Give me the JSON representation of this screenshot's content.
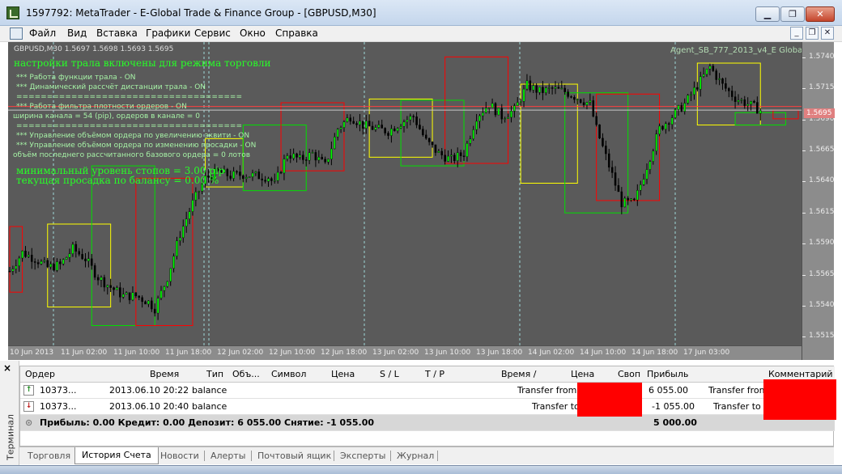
{
  "window": {
    "title": "1597792: MetaTrader - E-Global Trade & Finance Group - [GBPUSD,M30]"
  },
  "menu": [
    "Файл",
    "Вид",
    "Вставка",
    "Графики",
    "Сервис",
    "Окно",
    "Справка"
  ],
  "chart": {
    "symbol_info": "GBPUSD,M30  1.5697 1.5698 1.5693 1.5695",
    "ea_name": "Agent_SB_777_2013_v4_E Global",
    "current_price": "1.5695",
    "price_labels": [
      "1.5740",
      "1.5715",
      "1.5690",
      "1.5665",
      "1.5640",
      "1.5615",
      "1.5590",
      "1.5565",
      "1.5540",
      "1.5515"
    ],
    "time_labels": [
      "10 Jun 2013",
      "11 Jun 02:00",
      "11 Jun 10:00",
      "11 Jun 18:00",
      "12 Jun 02:00",
      "12 Jun 10:00",
      "12 Jun 18:00",
      "13 Jun 02:00",
      "13 Jun 10:00",
      "13 Jun 18:00",
      "14 Jun 02:00",
      "14 Jun 10:00",
      "14 Jun 18:00",
      "17 Jun 03:00"
    ],
    "indicator_lines": [
      "настройки трала включены для режима  торговли",
      "*** Работа функции трала -   ON",
      "*** Динамический рассчёт дистанции трала -   ON",
      "=====================================",
      "*** Работа фильтра плотности ордеров -   ON",
      "ширина канала = 54 (pip), ордеров в канале =  0",
      "=====================================",
      "*** Управление объёмом ордера по увеличению эквити -   ON",
      "*** Управление объёмом ордера по изменению просадки -   ON",
      "объём последнего рассчитанного базового ордера =  0 лотов",
      "минимальный уровень стопов =  3.00 pip",
      "текущая просадка по балансу =  0.00 %"
    ],
    "colors": {
      "background": "#5a5a5a",
      "bull": "#00ff00",
      "bear": "#000000",
      "box_yellow": "#ffff00",
      "box_green": "#00e000",
      "box_red": "#ff0000",
      "price_line": "#ff4040"
    }
  },
  "chart_data": {
    "type": "candlestick",
    "symbol": "GBPUSD",
    "timeframe": "M30",
    "ylim": [
      1.5505,
      1.575
    ],
    "y_ticks": [
      1.574,
      1.5715,
      1.569,
      1.5665,
      1.564,
      1.5615,
      1.559,
      1.5565,
      1.554,
      1.5515
    ],
    "x_ticks": [
      "10 Jun 2013",
      "11 Jun 02:00",
      "11 Jun 10:00",
      "11 Jun 18:00",
      "12 Jun 02:00",
      "12 Jun 10:00",
      "12 Jun 18:00",
      "13 Jun 02:00",
      "13 Jun 10:00",
      "13 Jun 18:00",
      "14 Jun 02:00",
      "14 Jun 10:00",
      "14 Jun 18:00",
      "17 Jun 03:00"
    ],
    "last_quote": {
      "open": 1.5697,
      "high": 1.5698,
      "low": 1.5693,
      "close": 1.5695
    },
    "close_path": [
      [
        0,
        1.5565
      ],
      [
        4,
        1.558
      ],
      [
        8,
        1.5575
      ],
      [
        12,
        1.5568
      ],
      [
        16,
        1.557
      ],
      [
        20,
        1.5583
      ],
      [
        24,
        1.5575
      ],
      [
        28,
        1.556
      ],
      [
        32,
        1.5552
      ],
      [
        36,
        1.5545
      ],
      [
        40,
        1.5545
      ],
      [
        44,
        1.554
      ],
      [
        46,
        1.5535
      ],
      [
        50,
        1.556
      ],
      [
        54,
        1.5595
      ],
      [
        58,
        1.562
      ],
      [
        62,
        1.564
      ],
      [
        66,
        1.5645
      ],
      [
        70,
        1.5642
      ],
      [
        74,
        1.5643
      ],
      [
        78,
        1.5642
      ],
      [
        82,
        1.5641
      ],
      [
        84,
        1.5635
      ],
      [
        88,
        1.566
      ],
      [
        92,
        1.5655
      ],
      [
        96,
        1.566
      ],
      [
        100,
        1.565
      ],
      [
        104,
        1.568
      ],
      [
        108,
        1.569
      ],
      [
        112,
        1.5683
      ],
      [
        116,
        1.568
      ],
      [
        120,
        1.5678
      ],
      [
        124,
        1.5685
      ],
      [
        128,
        1.569
      ],
      [
        132,
        1.567
      ],
      [
        136,
        1.566
      ],
      [
        140,
        1.5655
      ],
      [
        144,
        1.566
      ],
      [
        148,
        1.569
      ],
      [
        152,
        1.57
      ],
      [
        156,
        1.569
      ],
      [
        160,
        1.5695
      ],
      [
        164,
        1.5715
      ],
      [
        168,
        1.571
      ],
      [
        172,
        1.5712
      ],
      [
        176,
        1.571
      ],
      [
        180,
        1.5705
      ],
      [
        184,
        1.57
      ],
      [
        186,
        1.568
      ],
      [
        190,
        1.565
      ],
      [
        194,
        1.562
      ],
      [
        198,
        1.562
      ],
      [
        202,
        1.565
      ],
      [
        206,
        1.568
      ],
      [
        210,
        1.569
      ],
      [
        214,
        1.57
      ],
      [
        218,
        1.5715
      ],
      [
        222,
        1.573
      ],
      [
        226,
        1.5715
      ],
      [
        230,
        1.5705
      ],
      [
        234,
        1.57
      ],
      [
        238,
        1.5695
      ]
    ],
    "channel_boxes": [
      {
        "color": "red",
        "x": [
          0,
          4
        ],
        "price": [
          1.5548,
          1.5601
        ]
      },
      {
        "color": "yellow",
        "x": [
          12,
          32
        ],
        "price": [
          1.5536,
          1.5603
        ]
      },
      {
        "color": "green",
        "x": [
          26,
          46
        ],
        "price": [
          1.5521,
          1.565
        ]
      },
      {
        "color": "red",
        "x": [
          40,
          58
        ],
        "price": [
          1.5521,
          1.564
        ]
      },
      {
        "color": "yellow",
        "x": [
          62,
          74
        ],
        "price": [
          1.5633,
          1.5672
        ]
      },
      {
        "color": "green",
        "x": [
          74,
          94
        ],
        "price": [
          1.563,
          1.5683
        ]
      },
      {
        "color": "red",
        "x": [
          86,
          106
        ],
        "price": [
          1.5646,
          1.5701
        ]
      },
      {
        "color": "yellow",
        "x": [
          114,
          134
        ],
        "price": [
          1.5657,
          1.5704
        ]
      },
      {
        "color": "green",
        "x": [
          124,
          144
        ],
        "price": [
          1.565,
          1.5703
        ]
      },
      {
        "color": "red",
        "x": [
          138,
          158
        ],
        "price": [
          1.5652,
          1.5738
        ]
      },
      {
        "color": "yellow",
        "x": [
          162,
          180
        ],
        "price": [
          1.5636,
          1.5716
        ]
      },
      {
        "color": "green",
        "x": [
          176,
          196
        ],
        "price": [
          1.5612,
          1.5709
        ]
      },
      {
        "color": "red",
        "x": [
          186,
          206
        ],
        "price": [
          1.5622,
          1.5708
        ]
      },
      {
        "color": "yellow",
        "x": [
          218,
          238
        ],
        "price": [
          1.5683,
          1.5733
        ]
      },
      {
        "color": "green",
        "x": [
          230,
          246
        ],
        "price": [
          1.5683,
          1.5693
        ]
      },
      {
        "color": "red",
        "x": [
          242,
          250
        ],
        "price": [
          1.5688,
          1.5695
        ]
      }
    ]
  },
  "terminal": {
    "side_label": "Терминал",
    "columns": [
      "Ордер",
      "Время",
      "Тип",
      "Объ...",
      "Символ",
      "Цена",
      "S / L",
      "T / P",
      "Время   /",
      "Цена",
      "Своп",
      "Прибыль",
      "Комментарий"
    ],
    "rows": [
      {
        "order": "10373...",
        "time": "2013.06.10 20:22",
        "type": "balance",
        "comment_left": "Transfer from 1",
        "profit": "6 055.00",
        "comment": "Transfer from"
      },
      {
        "order": "10373...",
        "time": "2013.06.10 20:40",
        "type": "balance",
        "comment_left": "Transfer to",
        "profit": "-1 055.00",
        "comment": "Transfer to"
      }
    ],
    "summary": "Прибыль: 0.00  Кредит: 0.00  Депозит: 6 055.00  Снятие: -1 055.00",
    "summary_total": "5 000.00",
    "tabs": [
      "Торговля",
      "История Счета",
      "Новости",
      "Алерты",
      "Почтовый ящик",
      "Эксперты",
      "Журнал"
    ],
    "active_tab": "История Счета"
  }
}
